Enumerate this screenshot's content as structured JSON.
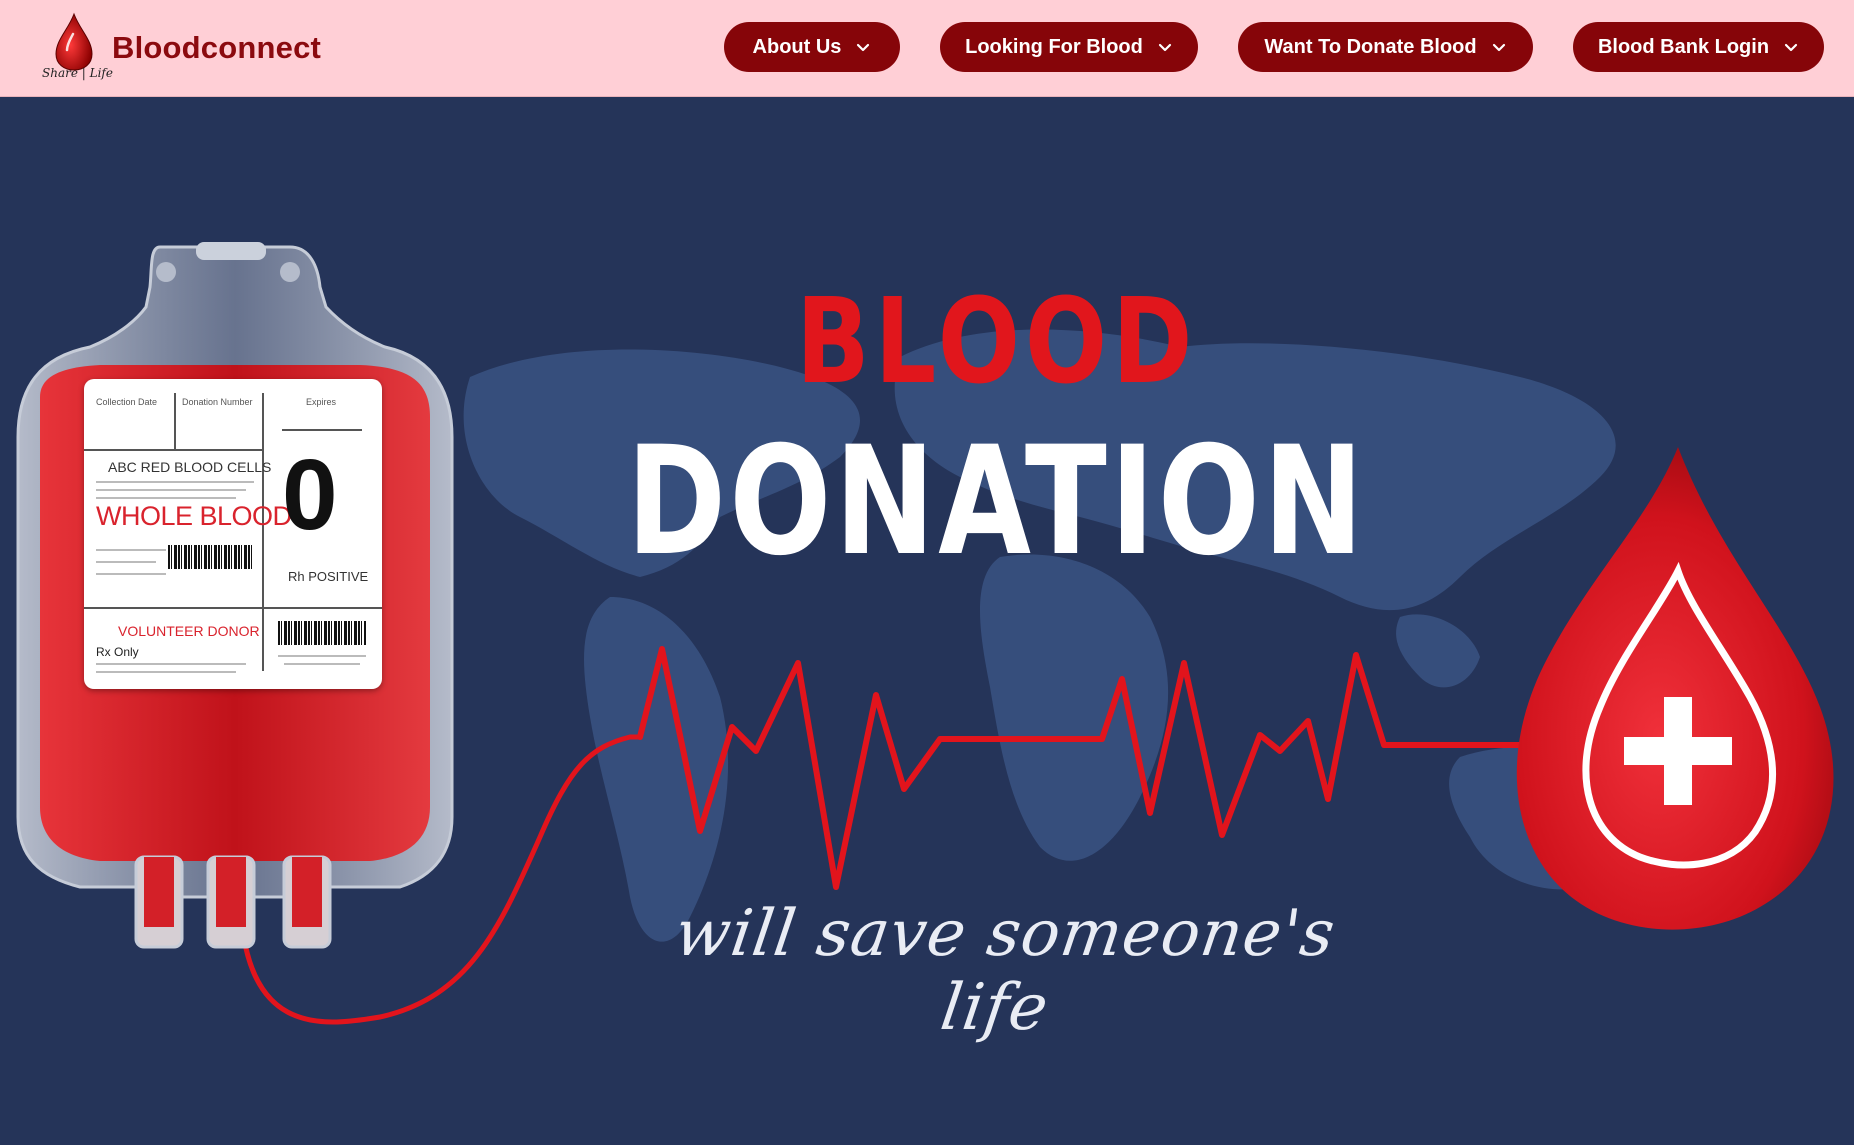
{
  "brand": {
    "name": "Bloodconnect",
    "logo_text": "Share Life",
    "logo_icon": "blood-drop-icon"
  },
  "nav": {
    "about": "About Us",
    "looking": "Looking For Blood",
    "donate": "Want To Donate Blood",
    "bank": "Blood Bank Login",
    "caret_icon": "chevron-down-icon"
  },
  "hero": {
    "title_line1": "BLOOD",
    "title_line2": "DONATION",
    "tagline": "will save someone's life",
    "bag_label": {
      "collection_date": "Collection Date",
      "donation_number": "Donation Number",
      "expires": "Expires",
      "product": "ABC RED BLOOD CELLS",
      "type": "WHOLE BLOOD",
      "group": "0",
      "rh": "Rh POSITIVE",
      "donor": "VOLUNTEER DONOR",
      "rx": "Rx Only"
    }
  },
  "colors": {
    "header_bg": "#ffcfd6",
    "nav_button": "#860509",
    "brand_text": "#8b0a0f",
    "hero_bg": "#253459",
    "accent_red": "#e1161c"
  }
}
